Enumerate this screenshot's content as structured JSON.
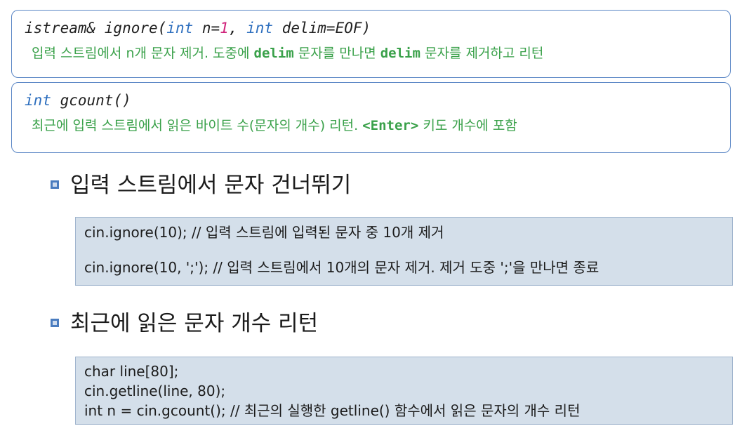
{
  "box1": {
    "sig_parts": [
      "istream& ignore(",
      "int",
      " n=",
      "1",
      ", ",
      "int",
      " delim=EOF)"
    ],
    "desc_parts": [
      "입력 스트림에서 n개 문자 제거. 도중에 ",
      "delim",
      " 문자를 만나면 ",
      "delim",
      " 문자를 제거하고 리턴"
    ]
  },
  "box2": {
    "sig_parts": [
      "int",
      " gcount()"
    ],
    "desc_parts": [
      "최근에 입력 스트림에서 읽은 바이트 수(문자의 개수) 리턴. ",
      "<Enter>",
      " 키도 개수에 포함"
    ]
  },
  "section1": {
    "heading": "입력 스트림에서 문자 건너뛰기",
    "code_lines": [
      "cin.ignore(10); // 입력 스트림에 입력된 문자 중 10개 제거",
      "cin.ignore(10, ';'); // 입력 스트림에서 10개의 문자 제거. 제거 도중 ';'을 만나면 종료"
    ]
  },
  "section2": {
    "heading": "최근에 읽은 문자 개수 리턴",
    "code_lines": [
      "char line[80];",
      "cin.getline(line, 80);",
      "int n = cin.gcount(); // 최근의 실행한 getline() 함수에서 읽은 문자의 개수 리턴"
    ]
  },
  "colors": {
    "keyword": "#2c6ebe",
    "number": "#d0237b",
    "description": "#3aa14a",
    "box_border": "#5a86c5",
    "code_background": "#d4dfea",
    "bullet": "#4a7cbf"
  }
}
